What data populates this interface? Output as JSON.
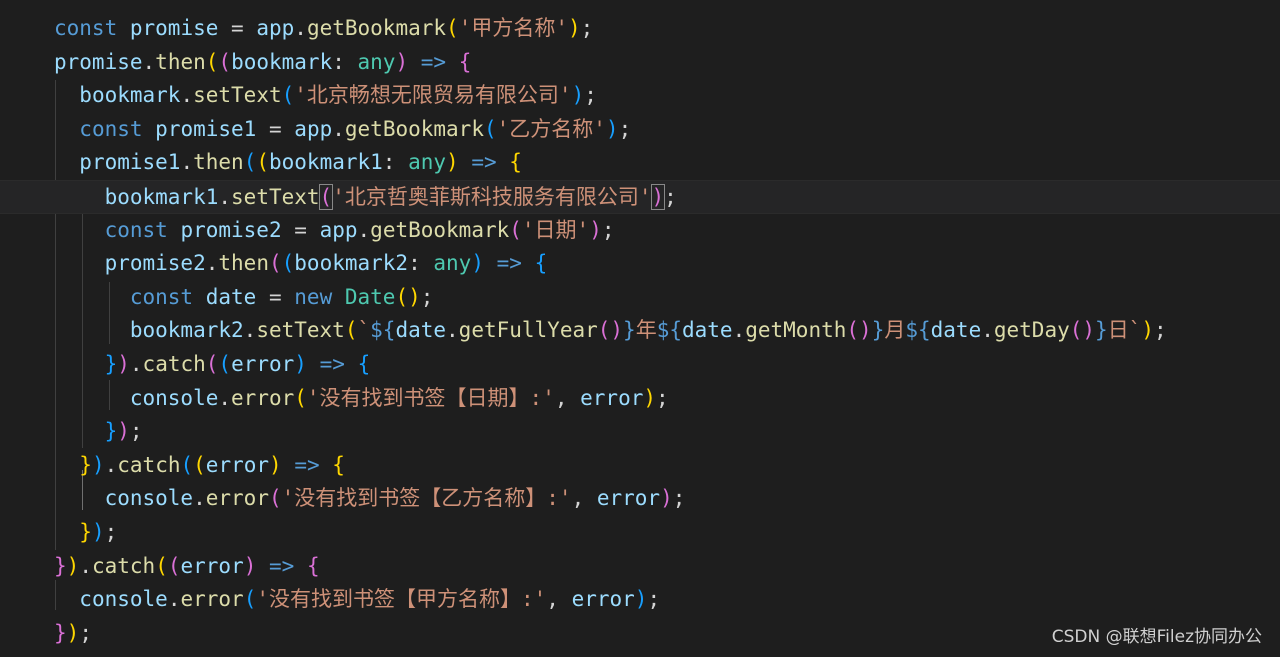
{
  "watermark": "CSDN @联想Filez协同办公",
  "code": {
    "s_jiafang": "'甲方名称'",
    "s_company1": "'北京畅想无限贸易有限公司'",
    "s_yifang": "'乙方名称'",
    "s_company2": "'北京哲奥菲斯科技服务有限公司'",
    "s_riqi": "'日期'",
    "s_err_riqi": "'没有找到书签【日期】:'",
    "s_err_yifang": "'没有找到书签【乙方名称】:'",
    "s_err_jiafang": "'没有找到书签【甲方名称】:'",
    "t_open": "`",
    "t_year": "年",
    "t_month": "月",
    "t_day": "日`"
  }
}
